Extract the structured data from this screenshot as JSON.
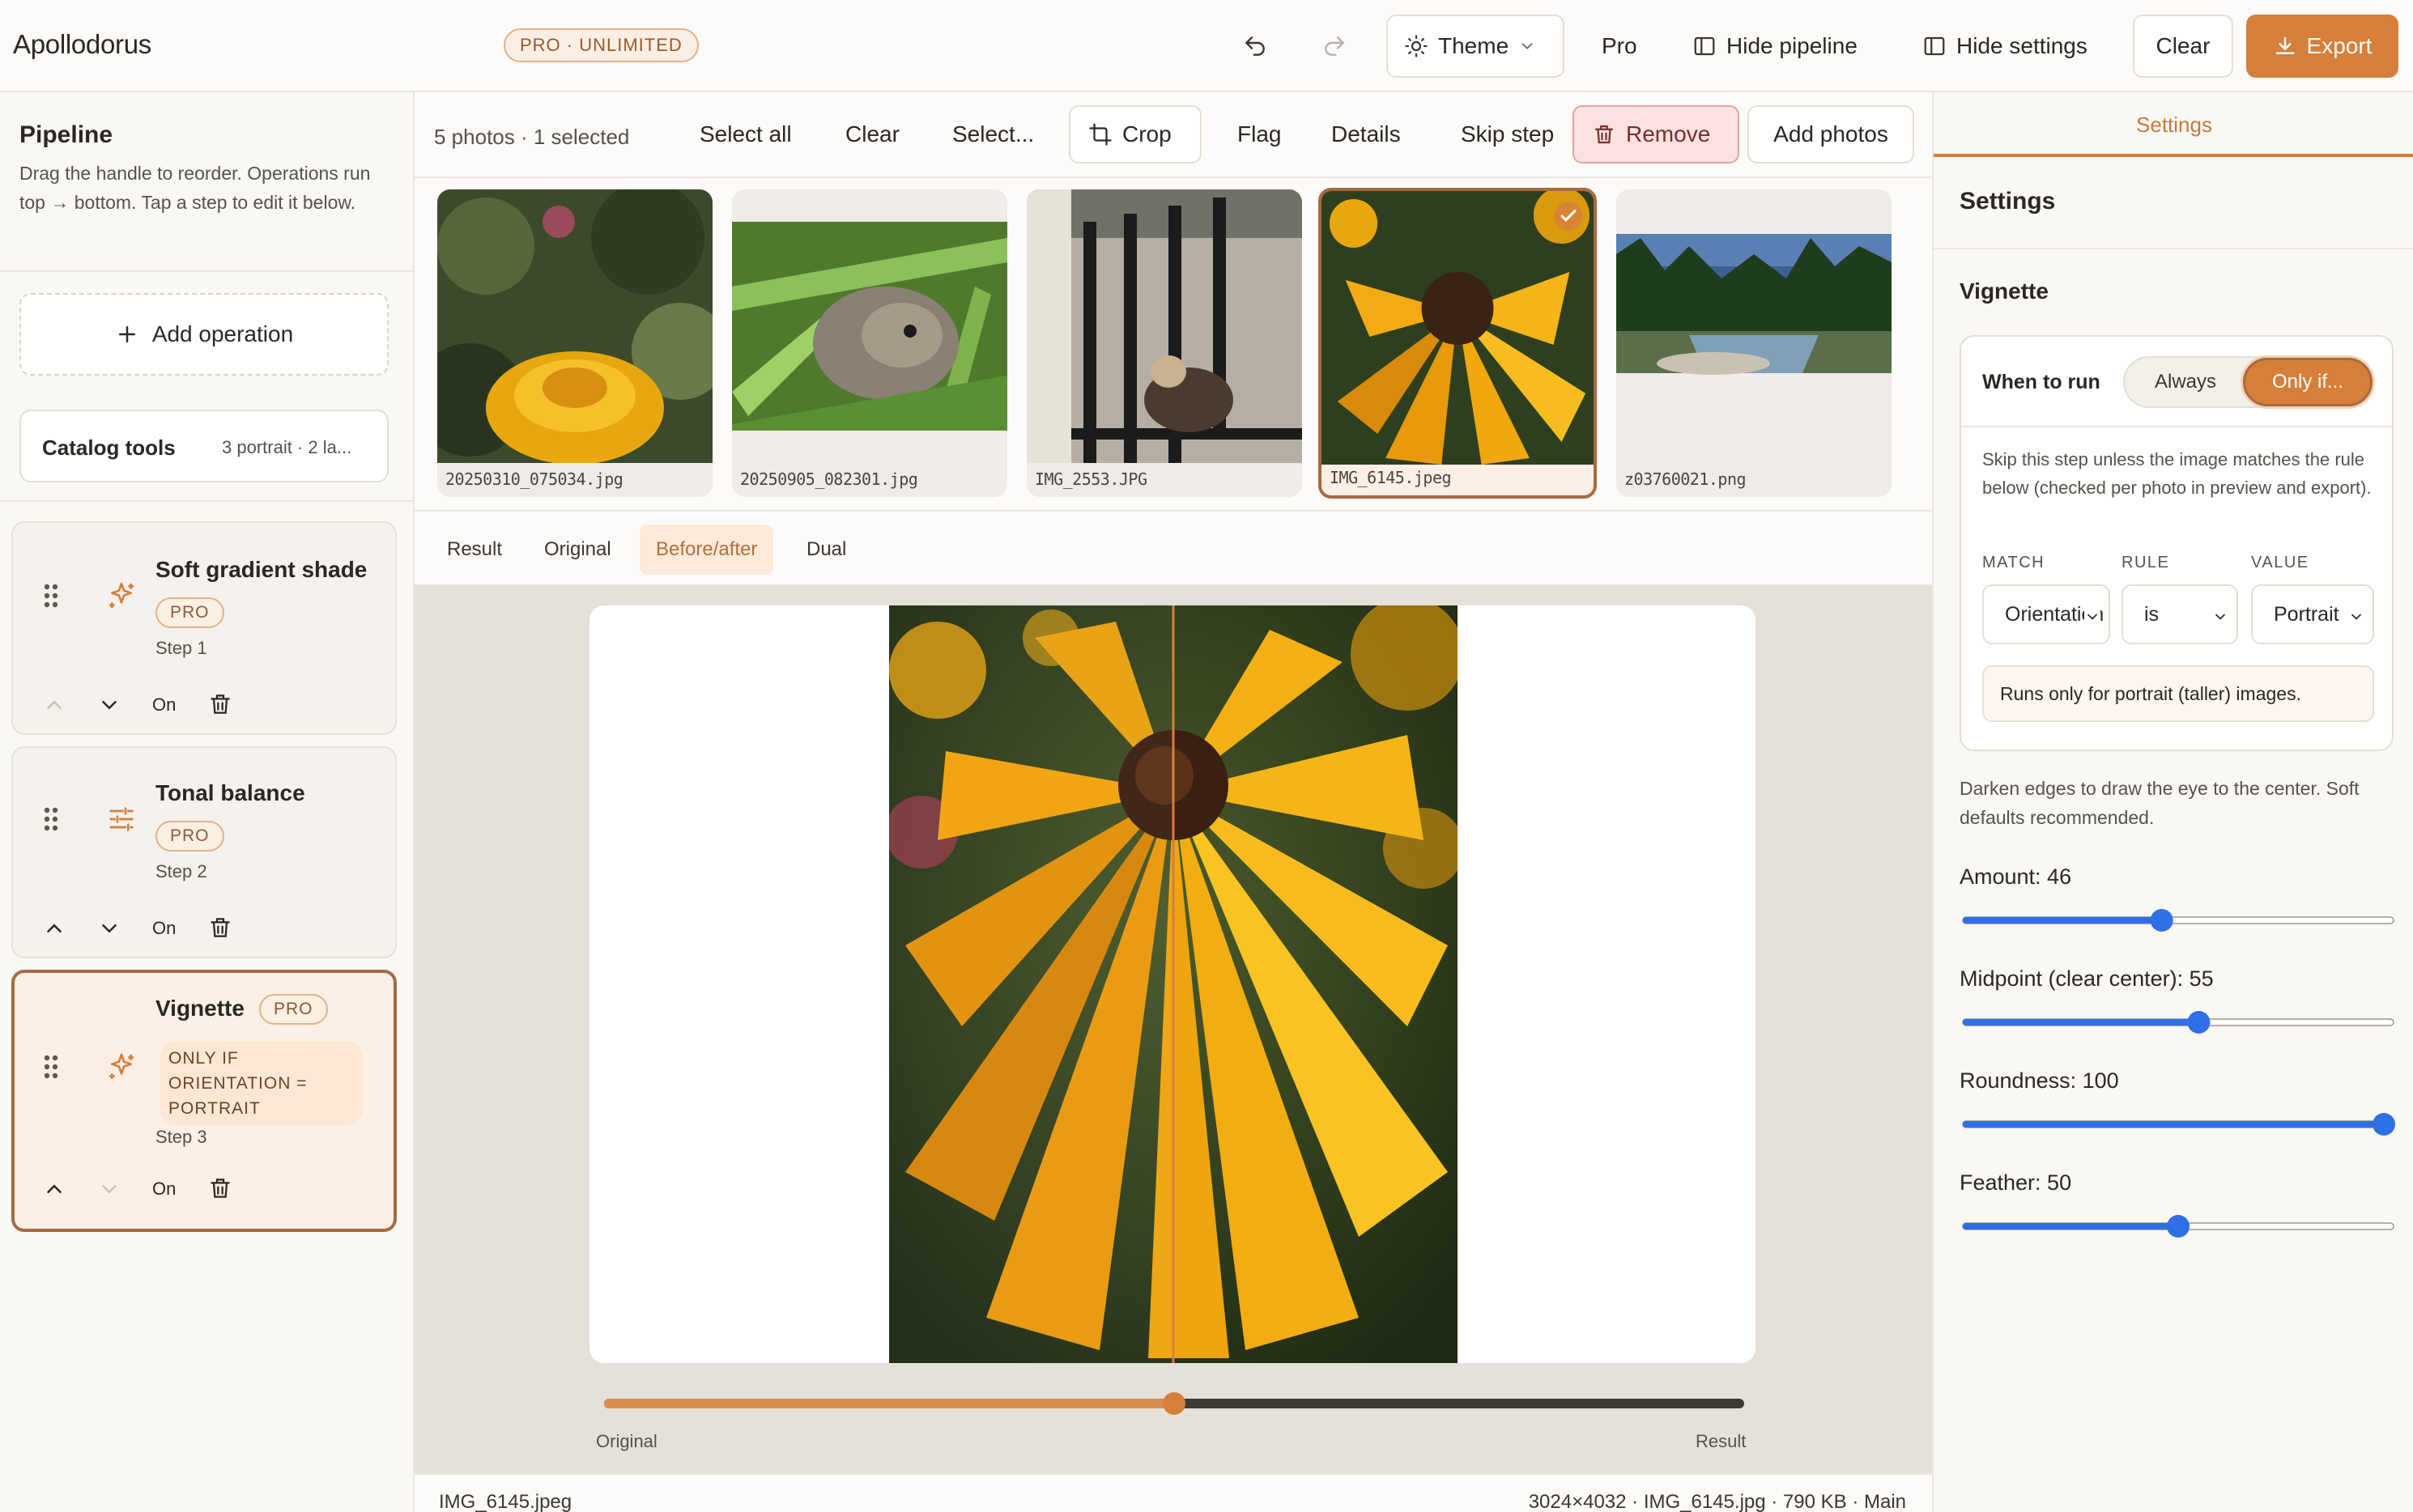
{
  "app": {
    "title": "Apollodorus",
    "plan_badge": "PRO · UNLIMITED"
  },
  "topbar": {
    "theme": "Theme",
    "pro": "Pro",
    "hide_pipeline": "Hide pipeline",
    "hide_settings": "Hide settings",
    "clear": "Clear",
    "export": "Export"
  },
  "sidebar": {
    "title": "Pipeline",
    "help": "Drag the handle to reorder. Operations run top → bottom. Tap a step to edit it below.",
    "add_operation": "Add operation",
    "catalog_label": "Catalog tools",
    "catalog_info": "3 portrait · 2 la...",
    "steps": [
      {
        "name": "Soft gradient shade",
        "badge": "PRO",
        "number": "Step 1",
        "toggle": "On",
        "icon": "sparkle-icon"
      },
      {
        "name": "Tonal balance",
        "badge": "PRO",
        "number": "Step 2",
        "toggle": "On",
        "icon": "sliders-icon"
      },
      {
        "name": "Vignette",
        "badge": "PRO",
        "condition": "ONLY IF ORIENTATION = PORTRAIT",
        "number": "Step 3",
        "toggle": "On",
        "icon": "sparkle-icon"
      }
    ]
  },
  "toolbar": {
    "count": "5 photos · 1 selected",
    "select_all": "Select all",
    "clear": "Clear",
    "select_menu": "Select...",
    "crop": "Crop",
    "flag": "Flag",
    "details": "Details",
    "skip_step": "Skip step",
    "remove": "Remove",
    "add_photos": "Add photos"
  },
  "photos": [
    {
      "name": "20250310_075034.jpg",
      "selected": false
    },
    {
      "name": "20250905_082301.jpg",
      "selected": false
    },
    {
      "name": "IMG_2553.JPG",
      "selected": false
    },
    {
      "name": "IMG_6145.jpeg",
      "selected": true
    },
    {
      "name": "z03760021.png",
      "selected": false
    }
  ],
  "view_tabs": [
    "Result",
    "Original",
    "Before/after",
    "Dual"
  ],
  "active_view": "Before/after",
  "compare": {
    "left_label": "Original",
    "right_label": "Result",
    "position": 0.5
  },
  "status": {
    "left": "IMG_6145.jpeg",
    "right": "3024×4032 · IMG_6145.jpg · 790 KB · Main"
  },
  "settings": {
    "tab": "Settings",
    "title": "Settings",
    "section": "Vignette",
    "when_to_run": "When to run",
    "always": "Always",
    "only_if": "Only if...",
    "condition_help": "Skip this step unless the image matches the rule below (checked per photo in preview and export).",
    "headers": {
      "match": "MATCH",
      "rule": "RULE",
      "value": "VALUE"
    },
    "match_value": "Orientation",
    "rule_value": "is",
    "value_value": "Portrait",
    "rule_note": "Runs only for portrait (taller) images.",
    "description": "Darken edges to draw the eye to the center. Soft defaults recommended.",
    "sliders": [
      {
        "label": "Amount: 46",
        "value": 46
      },
      {
        "label": "Midpoint (clear center): 55",
        "value": 55
      },
      {
        "label": "Roundness: 100",
        "value": 100
      },
      {
        "label": "Feather: 50",
        "value": 50
      }
    ]
  },
  "colors": {
    "accent": "#d67f3a",
    "selection_border": "#a86a40",
    "slider": "#2f6fe8"
  }
}
